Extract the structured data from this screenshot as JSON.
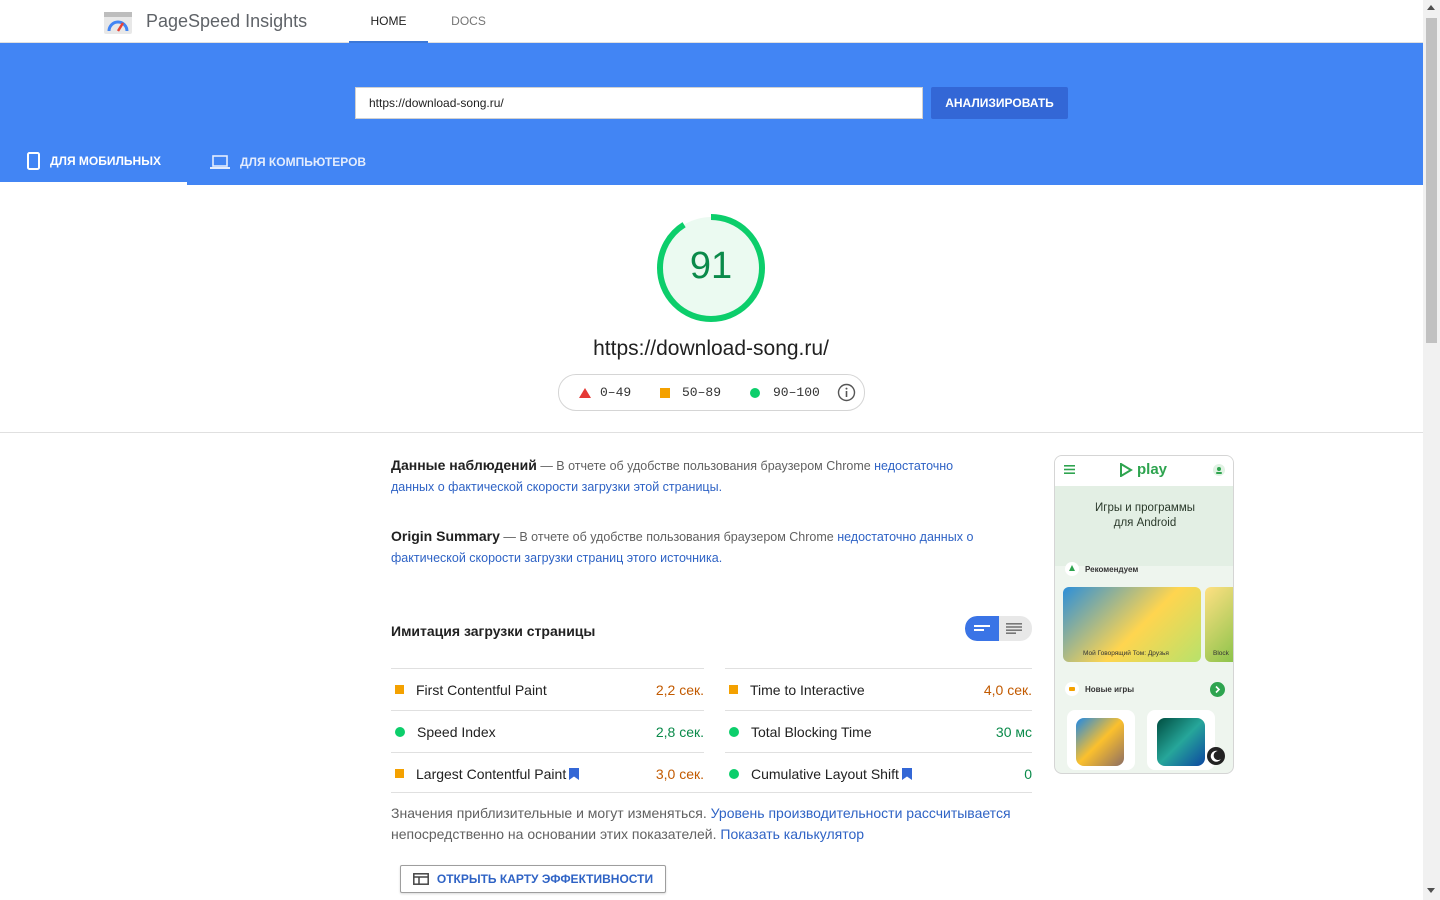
{
  "app": {
    "brand": "PageSpeed Insights",
    "nav_home": "HOME",
    "nav_docs": "DOCS"
  },
  "search": {
    "value": "https://download-song.ru/",
    "analyze_label": "АНАЛИЗИРОВАТЬ"
  },
  "tabs": {
    "mobile": "ДЛЯ МОБИЛЬНЫХ",
    "desktop": "ДЛЯ КОМПЬЮТЕРОВ"
  },
  "score": {
    "value": "91",
    "fraction": 0.91,
    "url": "https://download-song.ru/",
    "legend": {
      "poor": "0–49",
      "average": "50–89",
      "good": "90–100"
    },
    "colors": {
      "good": "#0cce6b",
      "average": "#f4a100",
      "poor": "#e53935"
    }
  },
  "field_data": {
    "title": "Данные наблюдений",
    "text": " — В отчете об удобстве пользования браузером Chrome ",
    "link_a": "недостаточно",
    "link_b": "данных о фактической скорости загрузки этой страницы."
  },
  "origin_summary": {
    "title": "Origin Summary",
    "text": " — В отчете об удобстве пользования браузером Chrome ",
    "link_a": "недостаточно данных",
    "link_b": "о фактической скорости загрузки страниц этого источника."
  },
  "lab": {
    "title": "Имитация загрузки страницы",
    "metrics": [
      {
        "label": "First Contentful Paint",
        "value": "2,2 сек.",
        "status": "average"
      },
      {
        "label": "Time to Interactive",
        "value": "4,0 сек.",
        "status": "average"
      },
      {
        "label": "Speed Index",
        "value": "2,8 сек.",
        "status": "good"
      },
      {
        "label": "Total Blocking Time",
        "value": "30 мс",
        "status": "good"
      },
      {
        "label": "Largest Contentful Paint",
        "value": "3,0 сек.",
        "status": "average"
      },
      {
        "label": "Cumulative Layout Shift",
        "value": "0",
        "status": "good"
      }
    ]
  },
  "note": {
    "text1": "Значения приблизительные и могут изменяться. ",
    "link1": "Уровень производительности рассчитывается",
    "text2": " непосредственно на основании этих показателей. ",
    "link2": "Показать калькулятор"
  },
  "treemap_label": "ОТКРЫТЬ КАРТУ ЭФФЕКТИВНОСТИ",
  "phone": {
    "logo": "play",
    "hero": "Игры и программы для Android",
    "recommended": "Рекомендуем",
    "card_caption": "Мой Говорящий Том: Друзья",
    "card2_caption": "Block",
    "new_games": "Новые игры"
  }
}
